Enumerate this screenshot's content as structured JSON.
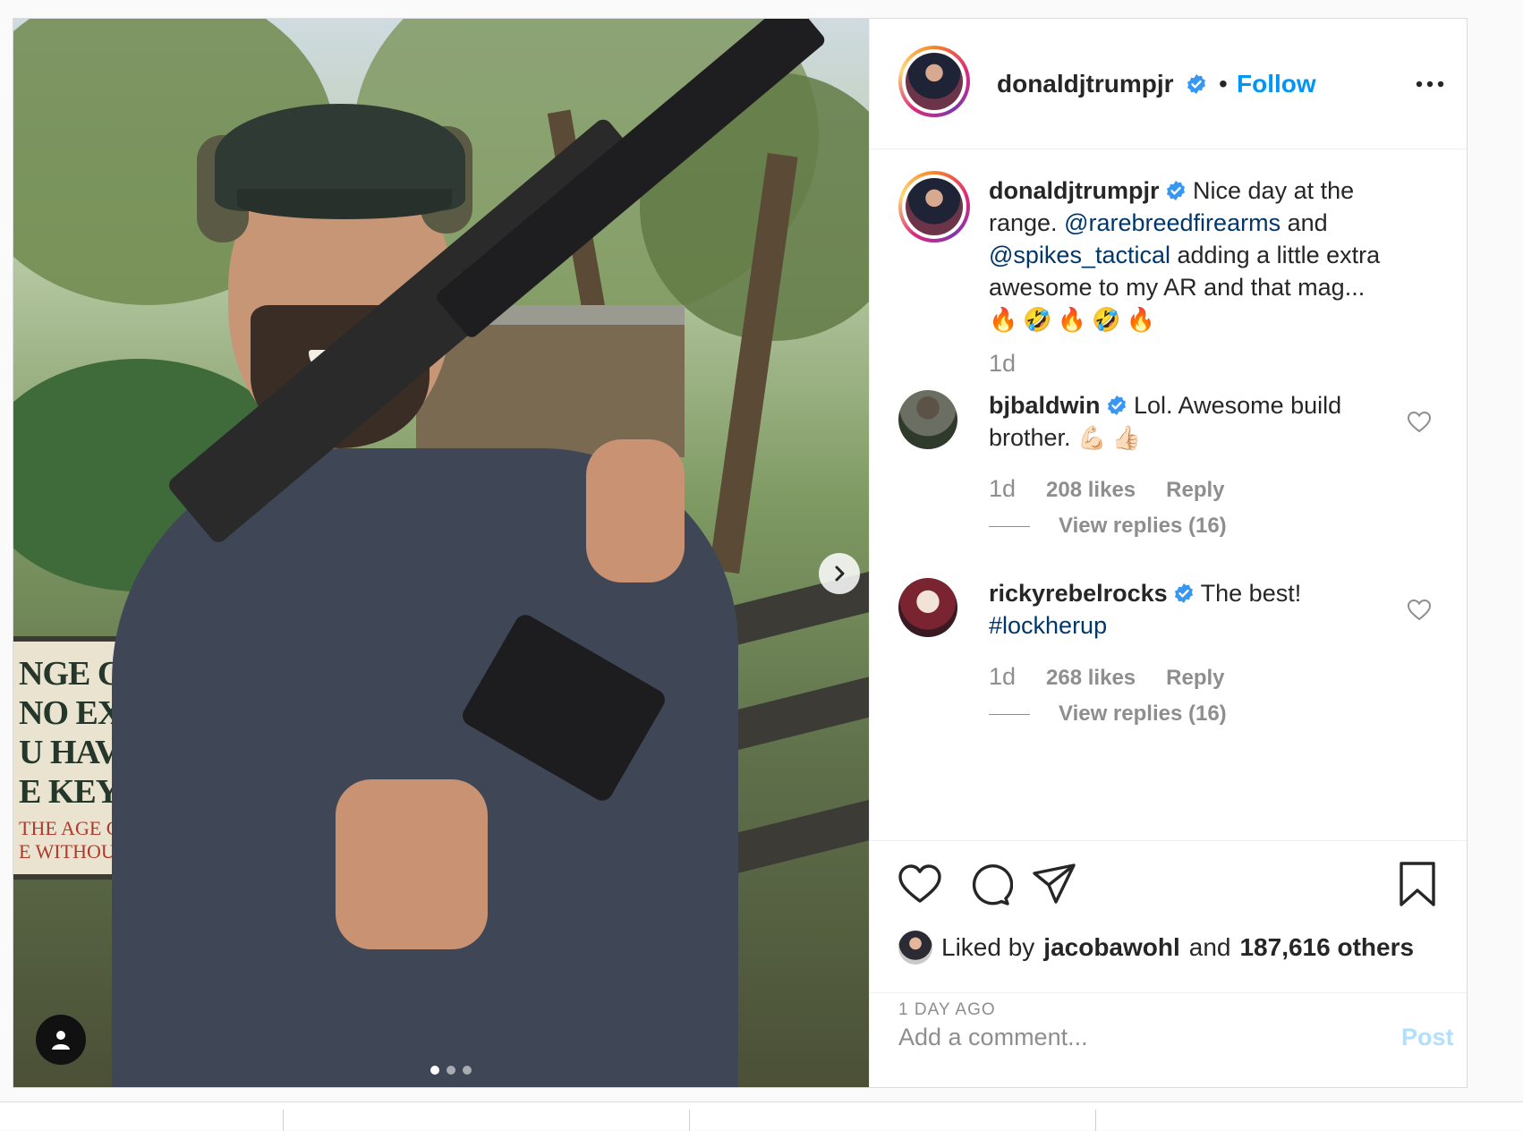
{
  "post": {
    "author": {
      "username": "donaldjtrumpjr",
      "verified": true,
      "separator": "•",
      "follow_label": "Follow"
    },
    "photo": {
      "carousel_count": 3,
      "active_index": 0,
      "sign_lines": [
        "NGE CLC",
        "NO EXCI",
        "U HAVE",
        "E KEY A",
        "THE AGE C",
        "E WITHOUT"
      ]
    },
    "caption": {
      "username": "donaldjtrumpjr",
      "text_1": "Nice day at the range.",
      "mention_1": "@rarebreedfirearms",
      "text_2": "and",
      "mention_2": "@spikes_tactical",
      "text_3": "adding a little extra awesome to my AR and that mag...",
      "emojis": "🔥🤣🔥🤣🔥",
      "time": "1d"
    },
    "comments": [
      {
        "username": "bjbaldwin",
        "text": "Lol. Awesome build brother.",
        "emojis": "💪🏻👍🏻",
        "time": "1d",
        "likes": "208 likes",
        "reply_label": "Reply",
        "view_replies": "View replies (16)"
      },
      {
        "username": "rickyrebelrocks",
        "text": "The best!",
        "hashtag": "#lockherup",
        "time": "1d",
        "likes": "268 likes",
        "reply_label": "Reply",
        "view_replies": "View replies (16)"
      }
    ],
    "likes": {
      "prefix": "Liked by",
      "user": "jacobawohl",
      "and": "and",
      "others": "187,616 others"
    },
    "timestamp": "1 DAY AGO",
    "comment_input": {
      "placeholder": "Add a comment...",
      "post_label": "Post"
    }
  },
  "colors": {
    "accent": "#0095f6",
    "mention": "#00376b",
    "muted": "#8e8e8e",
    "post_disabled": "#b2dffc"
  },
  "icons": [
    "verified-badge-icon",
    "more-options-icon",
    "heart-icon",
    "comment-icon",
    "share-icon",
    "bookmark-icon",
    "chevron-right-icon",
    "user-tag-icon"
  ]
}
